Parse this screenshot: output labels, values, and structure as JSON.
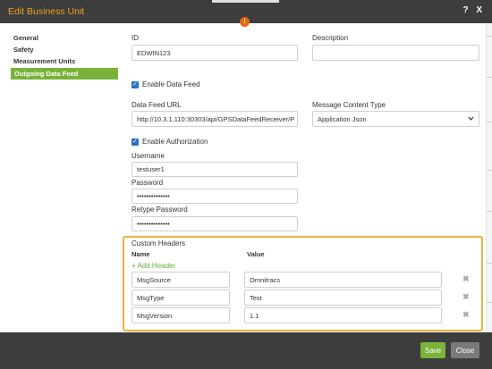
{
  "window": {
    "title": "Edit Business Unit",
    "controls": "? X",
    "badge": "!"
  },
  "sidebar": {
    "items": [
      "General",
      "Safety",
      "Measurement Units",
      "Outgoing Data Feed"
    ],
    "active_index": 3
  },
  "form": {
    "id_label": "ID",
    "id_value": "EDWIN123",
    "description_label": "Description",
    "description_value": "",
    "enable_feed_label": "Enable Data Feed",
    "enable_feed_checked": true,
    "url_label": "Data Feed URL",
    "url_value": "http://10.3.1.110:30303/api/GPSDataFeedReceiver/P",
    "content_type_label": "Message Content Type",
    "content_type_value": "Application Json",
    "enable_auth_label": "Enable Authorization",
    "enable_auth_checked": true,
    "username_label": "Username",
    "username_value": "testuser1",
    "password_label": "Password",
    "password_value": "••••••••••••••",
    "retype_label": "Retype Password",
    "retype_value": "••••••••••••••"
  },
  "custom_headers": {
    "section_label": "Custom Headers",
    "col_name": "Name",
    "col_value": "Value",
    "add_label": "+ Add Header",
    "rows": [
      {
        "name": "MsgSource",
        "value": "Omnitracs"
      },
      {
        "name": "MsgType",
        "value": "Test"
      },
      {
        "name": "MsgVersion",
        "value": "1.1"
      }
    ],
    "remove_icon": "✖"
  },
  "footer": {
    "save_label": "Save",
    "close_label": "Close"
  },
  "colors": {
    "accent": "#7ab23a",
    "title": "#f0a020",
    "highlight": "#e8b43a",
    "checkbox": "#2f6fc4"
  }
}
